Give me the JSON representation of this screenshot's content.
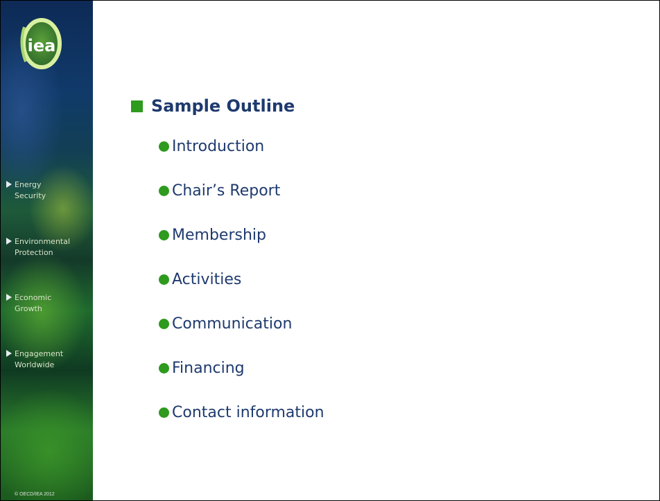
{
  "sidebar": {
    "logo_text": "iea",
    "nav_items": [
      {
        "line1": "Energy",
        "line2": "Security"
      },
      {
        "line1": "Environmental",
        "line2": "Protection"
      },
      {
        "line1": "Economic",
        "line2": "Growth"
      },
      {
        "line1": "Engagement",
        "line2": "Worldwide"
      }
    ],
    "copyright": "© OECD/IEA 2012"
  },
  "main": {
    "title": "Sample Outline",
    "items": [
      "Introduction",
      "Chair’s Report",
      "Membership",
      "Activities",
      "Communication",
      "Financing",
      "Contact information"
    ]
  },
  "colors": {
    "title_text": "#1e3a6e",
    "bullet": "#2e9a1e",
    "sidebar_top": "#0e2a56",
    "sidebar_bottom": "#1b5a1e"
  },
  "icons": {
    "title_bullet": "square-bullet-icon",
    "item_bullet": "circle-bullet-icon",
    "nav_arrow": "triangle-right-icon"
  }
}
